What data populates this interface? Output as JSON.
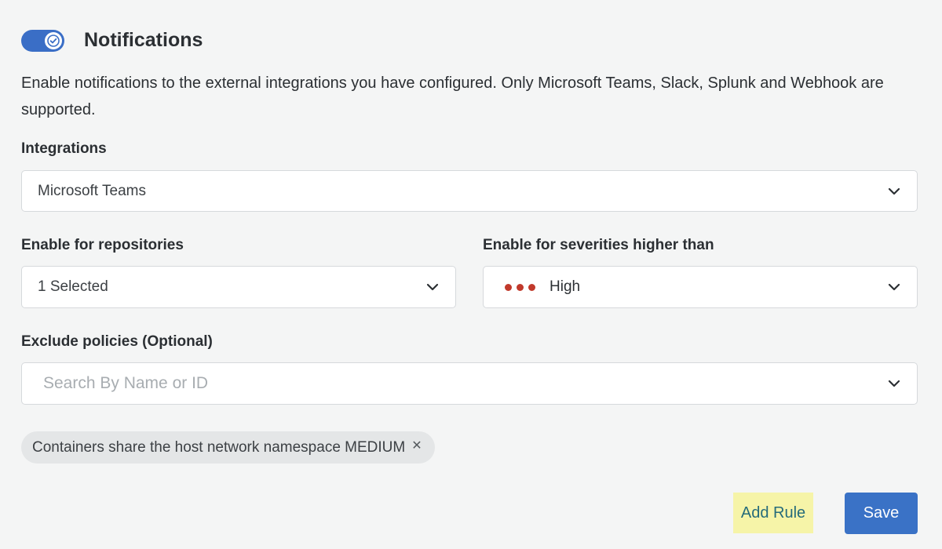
{
  "header": {
    "toggle_on": true,
    "title": "Notifications"
  },
  "description": "Enable notifications to the external integrations you have configured. Only Microsoft Teams, Slack, Splunk and Webhook are supported.",
  "integrations": {
    "label": "Integrations",
    "value": "Microsoft Teams"
  },
  "repositories": {
    "label": "Enable for repositories",
    "value": "1 Selected"
  },
  "severities": {
    "label": "Enable for severities higher than",
    "value": "High",
    "indicator_color": "#c1392b"
  },
  "exclude": {
    "label": "Exclude policies (Optional)",
    "placeholder": "Search By Name or ID"
  },
  "chips": [
    {
      "text": "Containers share the host network namespace MEDIUM"
    }
  ],
  "buttons": {
    "add_rule": "Add Rule",
    "save": "Save"
  },
  "colors": {
    "accent": "#3a72c6",
    "highlight": "#f6f4a8",
    "link": "#256b7a"
  }
}
